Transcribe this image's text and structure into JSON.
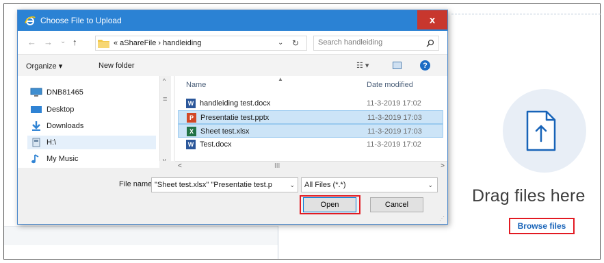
{
  "dialog": {
    "title": "Choose File to Upload",
    "close_label": "x",
    "nav": {
      "back": "←",
      "forward": "→",
      "recent": "⌄",
      "up": "↑"
    },
    "address": {
      "path": "« aShareFile › handleiding",
      "dropdown": "⌄",
      "refresh": "↻"
    },
    "search": {
      "placeholder": "Search handleiding"
    },
    "toolbar": {
      "organize": "Organize ▾",
      "new_folder": "New folder",
      "views": "☷ ▾",
      "help": "?"
    },
    "nav_pane": {
      "items": [
        {
          "label": "DNB81465",
          "icon": "computer-icon"
        },
        {
          "label": "Desktop",
          "icon": "desktop-icon"
        },
        {
          "label": "Downloads",
          "icon": "downloads-icon"
        },
        {
          "label": "H:\\",
          "icon": "drive-icon"
        },
        {
          "label": "My Music",
          "icon": "music-icon"
        }
      ],
      "scroll_up": "^",
      "scroll_down": "v",
      "scroll_thumb": "≡"
    },
    "file_list": {
      "columns": {
        "name": "Name",
        "date": "Date modified"
      },
      "sort_indicator": "▲",
      "files": [
        {
          "name": "handleiding test.docx",
          "date": "11-3-2019 17:02",
          "type": "word",
          "selected": false
        },
        {
          "name": "Presentatie test.pptx",
          "date": "11-3-2019 17:03",
          "type": "powerpoint",
          "selected": true
        },
        {
          "name": "Sheet test.xlsx",
          "date": "11-3-2019 17:03",
          "type": "excel",
          "selected": true
        },
        {
          "name": "Test.docx",
          "date": "11-3-2019 17:02",
          "type": "word",
          "selected": false
        }
      ],
      "hscroll": {
        "left": "<",
        "thumb": "III",
        "right": ">"
      }
    },
    "file_name": {
      "label": "File name:",
      "value": "\"Sheet test.xlsx\" \"Presentatie test.p",
      "dropdown": "⌄"
    },
    "file_type": {
      "value": "All Files (*.*)",
      "dropdown": "⌄"
    },
    "buttons": {
      "open": "Open",
      "cancel": "Cancel"
    },
    "icon_letters": {
      "word": "W",
      "powerpoint": "P",
      "excel": "X"
    }
  },
  "upload": {
    "drag_text": "Drag files here",
    "browse_label": "Browse files",
    "icon": "upload-file-icon"
  },
  "colors": {
    "titlebar": "#2b82d4",
    "close": "#c8372e",
    "highlight": "#e21a22",
    "link": "#1763b8",
    "word": "#2b579a",
    "powerpoint": "#d24726",
    "excel": "#217346"
  }
}
